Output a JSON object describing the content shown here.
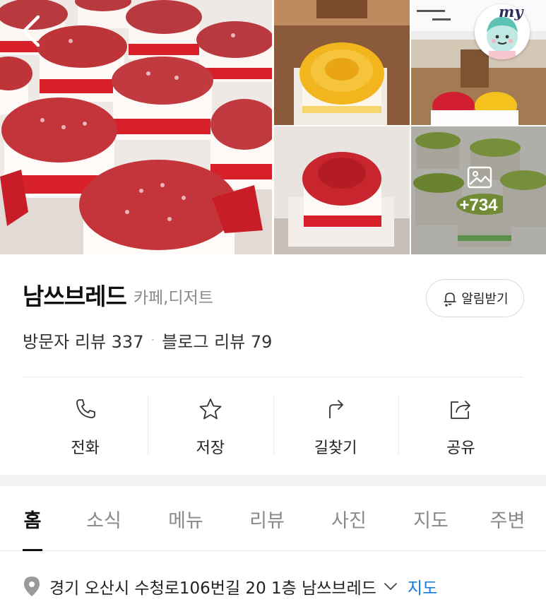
{
  "gallery": {
    "my_label": "my",
    "more_count": "+734",
    "icons": {
      "back": "chevron-left-icon",
      "more": "image-icon",
      "avatar": "my-avatar-icon"
    }
  },
  "place": {
    "name": "남쓰브레드",
    "category": "카페,디저트",
    "alarm_label": "알림받기"
  },
  "reviews": {
    "visitor": "방문자 리뷰 337",
    "separator": "·",
    "blog": "블로그 리뷰 79"
  },
  "actions": [
    {
      "label": "전화",
      "icon": "phone-icon"
    },
    {
      "label": "저장",
      "icon": "star-icon"
    },
    {
      "label": "길찾기",
      "icon": "directions-icon"
    },
    {
      "label": "공유",
      "icon": "share-icon"
    }
  ],
  "tabs": [
    {
      "label": "홈",
      "active": true
    },
    {
      "label": "소식",
      "active": false
    },
    {
      "label": "메뉴",
      "active": false
    },
    {
      "label": "리뷰",
      "active": false
    },
    {
      "label": "사진",
      "active": false
    },
    {
      "label": "지도",
      "active": false
    },
    {
      "label": "주변",
      "active": false
    }
  ],
  "address": {
    "text": "경기 오산시 수청로106번길 20 1층 남쓰브레드",
    "map_link": "지도"
  },
  "colors": {
    "link_blue": "#0a7be6",
    "cake_red": "#c8252e",
    "ribbon_red": "#d8202a",
    "matcha_green": "#9bbf4a",
    "mango_yellow": "#f2b51e"
  }
}
